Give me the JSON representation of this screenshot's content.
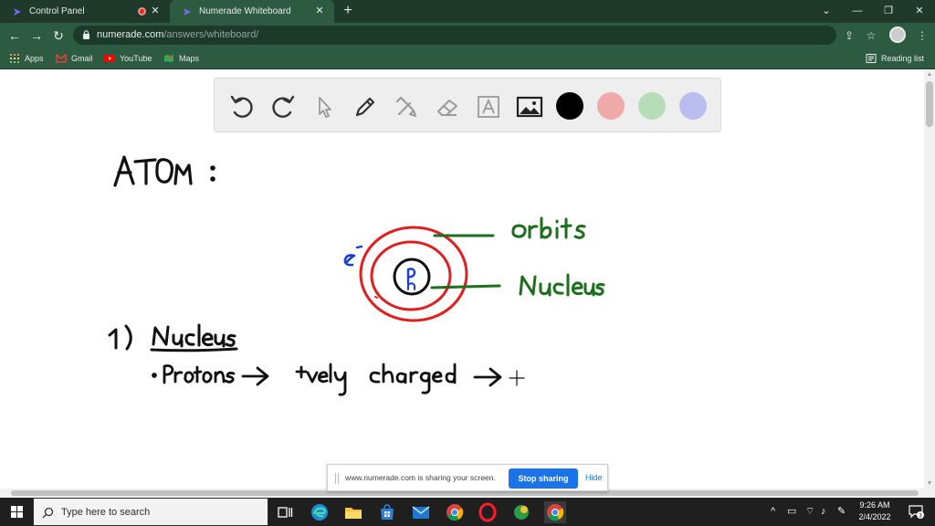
{
  "browser": {
    "tabs": [
      {
        "title": "Control Panel"
      },
      {
        "title": "Numerade Whiteboard"
      }
    ],
    "url_domain": "numerade.com",
    "url_path": "/answers/whiteboard/",
    "bookmarks": [
      {
        "label": "Apps"
      },
      {
        "label": "Gmail"
      },
      {
        "label": "YouTube"
      },
      {
        "label": "Maps"
      }
    ],
    "reading_list": "Reading list"
  },
  "whiteboard": {
    "colors": [
      "#000000",
      "#f0a9a9",
      "#b7dcb8",
      "#b9bdf0"
    ]
  },
  "share_banner": {
    "message": "www.numerade.com is sharing your screen.",
    "stop_label": "Stop sharing",
    "hide_label": "Hide"
  },
  "taskbar": {
    "search_placeholder": "Type here to search",
    "time": "9:26 AM",
    "date": "2/4/2022",
    "notification_count": "3"
  }
}
